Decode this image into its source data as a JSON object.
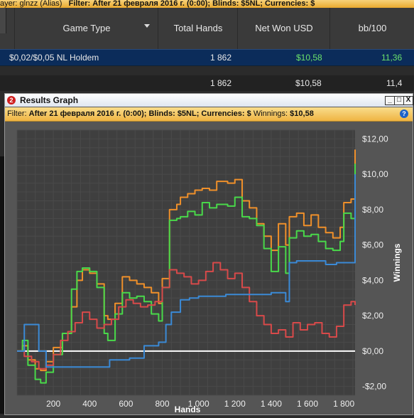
{
  "filter_bar": {
    "player_fragment": "ayer: glnzz (Alias)",
    "filter_label": "Filter:",
    "filter_text": "After 21 февраля 2016 г. (0:00); Blinds: $5NL; Currencies: $"
  },
  "table": {
    "headers": [
      "Game Type",
      "Total Hands",
      "Net Won USD",
      "bb/100"
    ],
    "row": {
      "game": "$0,02/$0,05 NL Holdem",
      "hands": "1 862",
      "net": "$10,58",
      "bb100": "11,36"
    },
    "total": {
      "hands": "1 862",
      "net": "$10,58",
      "bb100": "11,4"
    },
    "colors": {
      "net_positive": "#6be36b",
      "row_selected": "#0b2c5a"
    }
  },
  "graph_window": {
    "badge": "2",
    "title": "Results Graph",
    "buttons": {
      "minimize": "_",
      "maximize": "□",
      "close": "X"
    },
    "filter_label": "Filter:",
    "filter_text": "After 21 февраля 2016 г. (0:00); Blinds: $5NL; Currencies: $",
    "winnings_label": "Winnings:",
    "winnings_value": "$10,58",
    "help": "?"
  },
  "chart_data": {
    "type": "line",
    "xlabel": "Hands",
    "ylabel": "Winnings",
    "xlim": [
      0,
      1862
    ],
    "ylim": [
      -2.5,
      12.5
    ],
    "x_ticks": [
      200,
      400,
      600,
      800,
      1000,
      1200,
      1400,
      1600,
      1800
    ],
    "x_tick_labels": [
      "200",
      "400",
      "600",
      "800",
      "1 000",
      "1 200",
      "1 400",
      "1 600",
      "1 800"
    ],
    "y_ticks": [
      -2,
      0,
      2,
      4,
      6,
      8,
      10,
      12
    ],
    "y_tick_labels": [
      "-$2,00",
      "$0,00",
      "$2,00",
      "$4,00",
      "$6,00",
      "$8,00",
      "$10,00",
      "$12,00"
    ],
    "grid": true,
    "series": [
      {
        "color": "#f0902a",
        "x": [
          0,
          30,
          60,
          100,
          130,
          160,
          200,
          250,
          300,
          330,
          360,
          400,
          440,
          480,
          500,
          540,
          580,
          620,
          660,
          700,
          740,
          780,
          800,
          840,
          880,
          900,
          940,
          980,
          1020,
          1060,
          1100,
          1160,
          1200,
          1240,
          1280,
          1320,
          1360,
          1400,
          1440,
          1480,
          1500,
          1540,
          1580,
          1620,
          1660,
          1700,
          1740,
          1780,
          1800,
          1840,
          1862
        ],
        "y": [
          0,
          0.3,
          -0.5,
          -1.0,
          -1.1,
          -0.6,
          0.2,
          1.0,
          2.5,
          4.0,
          4.6,
          4.4,
          3.8,
          2.0,
          1.8,
          2.7,
          4.2,
          4.0,
          3.8,
          3.6,
          3.3,
          2.7,
          4.1,
          8.0,
          8.3,
          8.7,
          8.9,
          9.1,
          9.2,
          9.1,
          9.6,
          9.5,
          9.7,
          8.5,
          8.1,
          7.2,
          6.5,
          5.7,
          7.2,
          6.0,
          7.6,
          7.8,
          7.1,
          7.7,
          7.0,
          6.7,
          6.4,
          7.0,
          8.4,
          8.6,
          11.4
        ]
      },
      {
        "color": "#49d94a",
        "x": [
          0,
          30,
          60,
          100,
          130,
          160,
          200,
          250,
          300,
          330,
          360,
          400,
          440,
          480,
          500,
          540,
          580,
          620,
          660,
          700,
          740,
          780,
          800,
          840,
          880,
          900,
          940,
          980,
          1020,
          1060,
          1100,
          1160,
          1200,
          1240,
          1280,
          1320,
          1360,
          1400,
          1440,
          1480,
          1500,
          1540,
          1580,
          1620,
          1660,
          1700,
          1740,
          1780,
          1800,
          1840,
          1862
        ],
        "y": [
          0,
          0.6,
          -0.8,
          -1.6,
          -1.8,
          -1.2,
          -0.2,
          1.0,
          3.5,
          4.5,
          4.7,
          4.5,
          3.6,
          1.0,
          0.6,
          2.1,
          3.3,
          3.0,
          3.1,
          2.8,
          2.1,
          1.7,
          3.6,
          7.4,
          7.5,
          7.6,
          7.9,
          7.7,
          8.4,
          8.1,
          8.3,
          8.2,
          8.7,
          7.6,
          7.5,
          7.1,
          5.8,
          4.5,
          5.9,
          4.4,
          6.4,
          6.8,
          6.5,
          6.6,
          6.2,
          5.8,
          5.7,
          6.2,
          7.8,
          7.5,
          10.6
        ]
      },
      {
        "color": "#d84a4a",
        "x": [
          0,
          40,
          80,
          120,
          160,
          200,
          240,
          280,
          320,
          360,
          400,
          440,
          480,
          520,
          560,
          600,
          640,
          680,
          720,
          760,
          800,
          840,
          880,
          920,
          960,
          1000,
          1040,
          1080,
          1120,
          1160,
          1200,
          1240,
          1280,
          1320,
          1360,
          1400,
          1440,
          1480,
          1520,
          1560,
          1600,
          1640,
          1680,
          1720,
          1760,
          1800,
          1840,
          1862
        ],
        "y": [
          0,
          -0.3,
          -0.6,
          -1.0,
          -0.8,
          -0.2,
          0.6,
          1.1,
          1.6,
          2.2,
          1.8,
          1.3,
          1.5,
          1.8,
          2.5,
          2.9,
          2.7,
          2.5,
          2.6,
          2.8,
          3.6,
          4.6,
          4.4,
          4.2,
          3.8,
          4.0,
          4.5,
          5.0,
          4.6,
          4.1,
          4.4,
          3.6,
          2.8,
          2.0,
          1.5,
          1.0,
          1.2,
          0.8,
          1.6,
          1.2,
          1.5,
          1.6,
          1.0,
          0.8,
          1.4,
          2.6,
          2.8,
          2.6
        ]
      },
      {
        "color": "#3b8ad6",
        "x": [
          0,
          25,
          40,
          110,
          120,
          160,
          500,
          510,
          560,
          620,
          700,
          780,
          820,
          850,
          900,
          950,
          1000,
          1050,
          1100,
          1150,
          1200,
          1300,
          1400,
          1460,
          1480,
          1500,
          1540,
          1580,
          1700,
          1760,
          1800,
          1840,
          1862
        ],
        "y": [
          0,
          0,
          1.5,
          1.5,
          0,
          -0.9,
          -0.9,
          -0.5,
          -0.5,
          -0.4,
          0.3,
          0.5,
          1.5,
          2.2,
          2.9,
          3.0,
          3.1,
          3.1,
          3.1,
          3.2,
          3.2,
          3.2,
          3.3,
          3.3,
          2.8,
          5.0,
          5.1,
          5.1,
          4.9,
          5.0,
          5.0,
          5.0,
          10.0
        ]
      }
    ],
    "reference_line": {
      "y": 0,
      "color": "#ffffff"
    }
  }
}
